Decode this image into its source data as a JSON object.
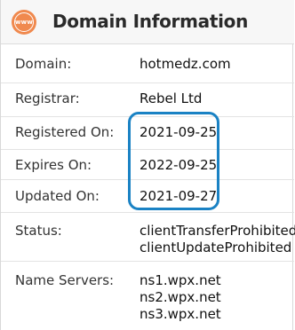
{
  "header": {
    "icon_text": "www",
    "title": "Domain Information"
  },
  "rows": [
    {
      "label": "Domain:",
      "values": [
        "hotmedz.com"
      ]
    },
    {
      "label": "Registrar:",
      "values": [
        "Rebel Ltd"
      ]
    },
    {
      "label": "Registered On:",
      "values": [
        "2021-09-25"
      ]
    },
    {
      "label": "Expires On:",
      "values": [
        "2022-09-25"
      ]
    },
    {
      "label": "Updated On:",
      "values": [
        "2021-09-27"
      ]
    },
    {
      "label": "Status:",
      "values": [
        "clientTransferProhibited",
        "clientUpdateProhibited"
      ]
    },
    {
      "label": "Name Servers:",
      "values": [
        "ns1.wpx.net",
        "ns2.wpx.net",
        "ns3.wpx.net"
      ]
    }
  ],
  "colors": {
    "accent_icon": "#f0894e",
    "highlight_ring": "#1a82c4"
  }
}
